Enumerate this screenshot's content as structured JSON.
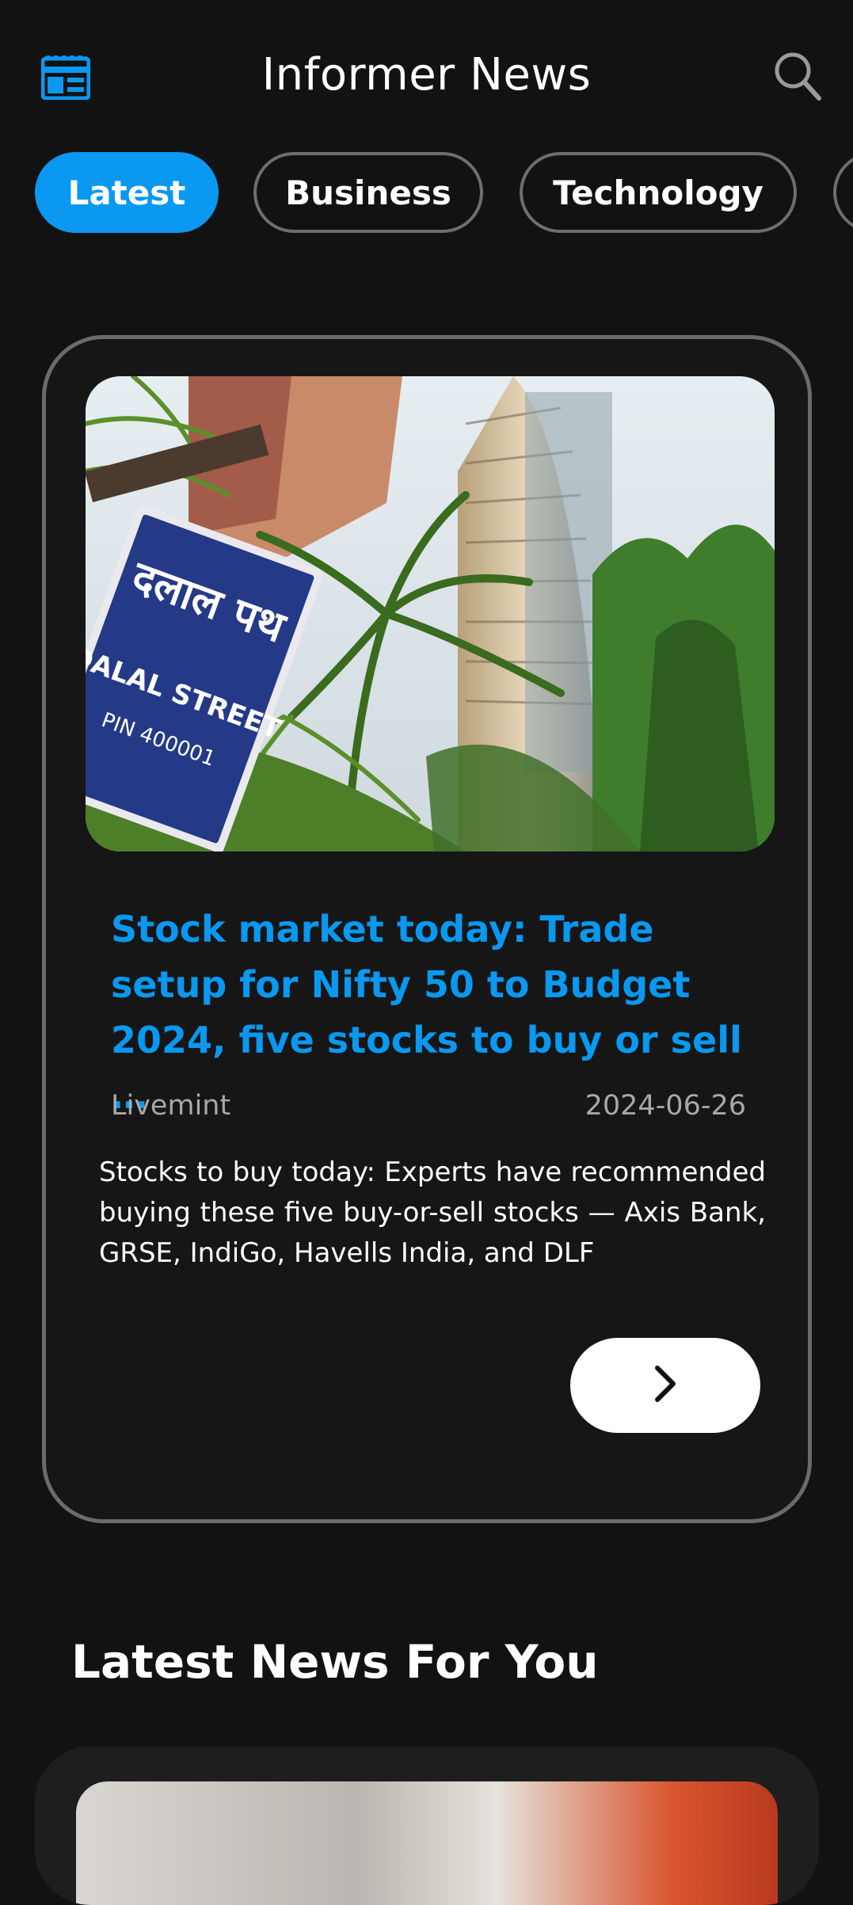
{
  "app": {
    "title": "Informer News"
  },
  "icons": {
    "logo": "newspaper-icon",
    "search": "search-icon",
    "read_more": "chevron-right-icon"
  },
  "colors": {
    "accent": "#0a98f0",
    "background": "#121212",
    "card_border": "#6b6b6b",
    "muted_text": "#a8a8a8"
  },
  "tabs": [
    {
      "label": "Latest",
      "active": true
    },
    {
      "label": "Business",
      "active": false
    },
    {
      "label": "Technology",
      "active": false
    }
  ],
  "featured": {
    "title": "Stock market today: Trade setup for Nifty 50 to Budget 2024, five stocks to buy or sell …",
    "source": "Livemint",
    "date": "2024-06-26",
    "description": "Stocks to buy today: Experts have recommended buying these five buy-or-sell stocks — Axis Bank, GRSE, IndiGo, Havells India, and DLF",
    "image_sign": {
      "line1": "दलाल पथ",
      "line2": "DALAL STREET",
      "line3": "PIN 400001"
    }
  },
  "section": {
    "title": "Latest News For You"
  }
}
